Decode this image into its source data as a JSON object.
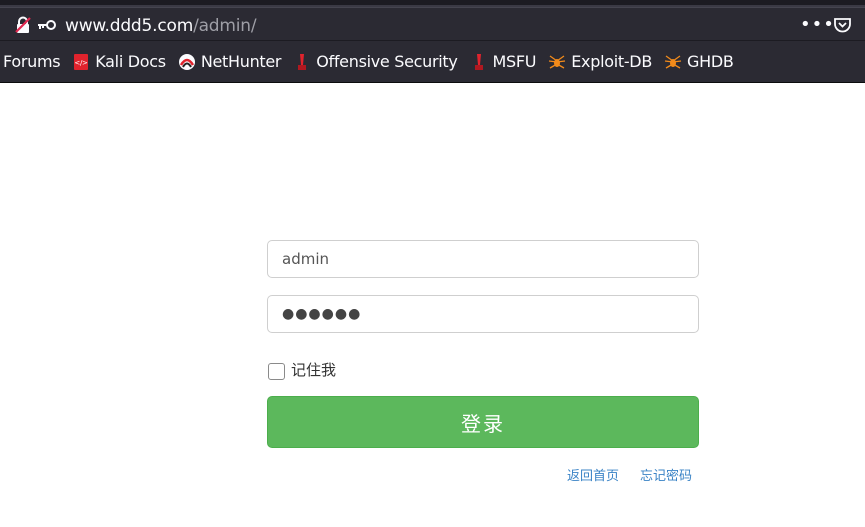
{
  "browser": {
    "url_domain": "www.ddd5.com",
    "url_path": "/admin/",
    "menu_dots": "•••"
  },
  "bookmarks": [
    {
      "label": "Forums",
      "icon": "none"
    },
    {
      "label": "Kali Docs",
      "icon": "kali-docs-icon"
    },
    {
      "label": "NetHunter",
      "icon": "nethunter-icon"
    },
    {
      "label": "Offensive Security",
      "icon": "offsec-icon"
    },
    {
      "label": "MSFU",
      "icon": "msfu-icon"
    },
    {
      "label": "Exploit-DB",
      "icon": "exploitdb-spider-icon"
    },
    {
      "label": "GHDB",
      "icon": "ghdb-spider-icon"
    }
  ],
  "login": {
    "username_value": "admin",
    "password_value": "●●●●●●",
    "remember_label": "记住我",
    "remember_checked": false,
    "submit_label": "登录",
    "home_link": "返回首页",
    "forgot_link": "忘记密码"
  },
  "colors": {
    "toolbar_bg": "#2b2a33",
    "button_green": "#5cb85c",
    "link_blue": "#3a83c6"
  }
}
